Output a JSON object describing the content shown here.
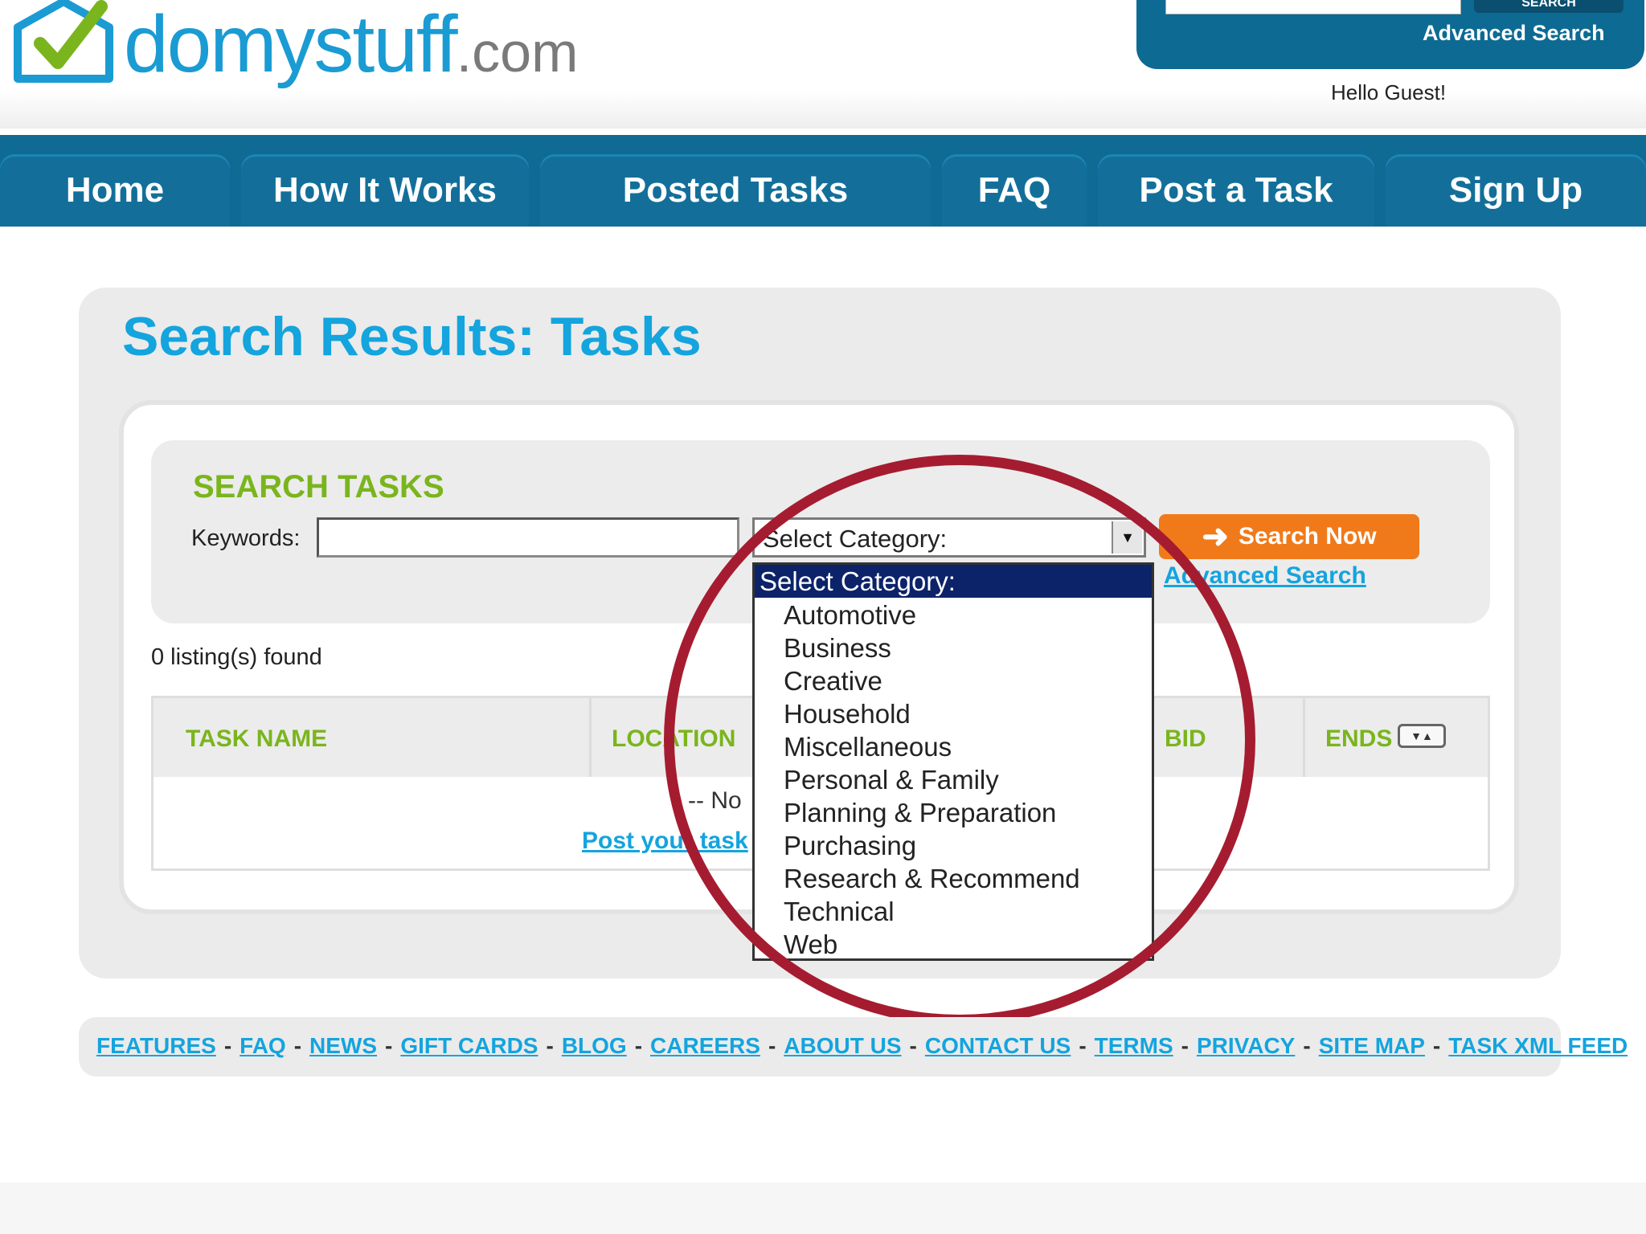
{
  "logo": {
    "text_main": "domystuff",
    "text_suffix": ".com"
  },
  "top_search": {
    "button_label": "SEARCH",
    "advanced_link": "Advanced Search"
  },
  "greeting": "Hello Guest!",
  "nav": {
    "items": [
      {
        "label": "Home"
      },
      {
        "label": "How It Works"
      },
      {
        "label": "Posted Tasks"
      },
      {
        "label": "FAQ"
      },
      {
        "label": "Post a Task"
      },
      {
        "label": "Sign Up"
      }
    ]
  },
  "page": {
    "title": "Search Results: Tasks"
  },
  "search": {
    "heading": "SEARCH TASKS",
    "keywords_label": "Keywords:",
    "keywords_value": "",
    "category_selected": "Select Category:",
    "button_label": "Search Now",
    "advanced_link": "Advanced Search"
  },
  "results": {
    "count_text": "0 listing(s) found",
    "columns": [
      "TASK NAME",
      "LOCATION",
      "BID",
      "ENDS"
    ],
    "empty_text": "-- No",
    "post_link": "Post your task"
  },
  "dropdown": {
    "header": "Select Category:",
    "options": [
      "Automotive",
      "Business",
      "Creative",
      "Household",
      "Miscellaneous",
      "Personal & Family",
      "Planning & Preparation",
      "Purchasing",
      "Research & Recommend",
      "Technical",
      "Web"
    ]
  },
  "footer": {
    "links": [
      "FEATURES",
      "FAQ",
      "NEWS",
      "GIFT CARDS",
      "BLOG",
      "CAREERS",
      "ABOUT US",
      "CONTACT US",
      "TERMS",
      "PRIVACY",
      "SITE MAP",
      "TASK XML FEED"
    ],
    "separator": "-"
  },
  "colors": {
    "brand_blue": "#14a4de",
    "nav_blue": "#0f6b94",
    "accent_green": "#7ab51d",
    "search_orange": "#f07a1a",
    "highlight_red": "#a51c30",
    "dropdown_selected": "#0c2369"
  },
  "icons": {
    "logo": "house-check-icon",
    "search_button": "arrow-right-icon",
    "category_select": "chevron-down-icon",
    "ends_sort": "sort-up-down-icon"
  }
}
